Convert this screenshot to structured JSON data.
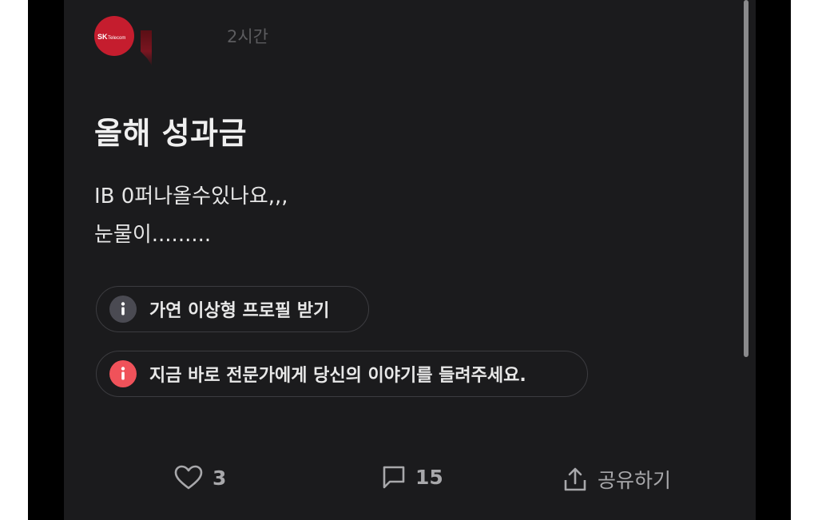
{
  "post": {
    "avatar_brand": "SK Telecom",
    "time": "2시간",
    "title": "올해 성과금",
    "body": "IB 0퍼나올수있나요,,,\n눈물이.........",
    "chips": [
      {
        "label": "가연 이상형 프로필 받기",
        "icon": "info-icon",
        "color": "#4a4a52"
      },
      {
        "label": "지금 바로 전문가에게 당신의 이야기를 들려주세요.",
        "icon": "info-icon",
        "color": "#f0525a"
      }
    ]
  },
  "actions": {
    "like_count": "3",
    "comment_count": "15",
    "share_label": "공유하기"
  },
  "colors": {
    "background": "#1b1b1d",
    "accent_red": "#f0525a",
    "brand_red": "#c51d2e"
  }
}
